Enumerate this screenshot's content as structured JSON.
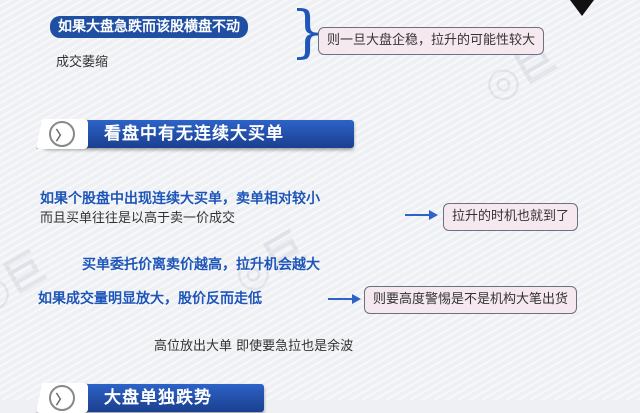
{
  "section1": {
    "pill_text": "如果大盘急跌而该股横盘不动",
    "sub_text": "成交萎缩",
    "box_text": "则一旦大盘企稳，拉升的可能性较大"
  },
  "section2": {
    "header": "看盘中有无连续大买单",
    "line1": "如果个股盘中出现连续大买单，卖单相对较小",
    "line2": "而且买单往往是以高于卖一价成交",
    "box1": "拉升的时机也就到了",
    "line3": "买单委托价离卖价越高，拉升机会越大",
    "line4": "如果成交量明显放大，股价反而走低",
    "box2": "则要高度警惕是不是机构大笔出货",
    "line5": "高位放出大单  即使要急拉也是余波"
  },
  "section3": {
    "header": "大盘单独跌势"
  },
  "colors": {
    "primary_blue": "#1f4fa3",
    "box_fill": "#f6e8ef",
    "text": "#333333"
  }
}
